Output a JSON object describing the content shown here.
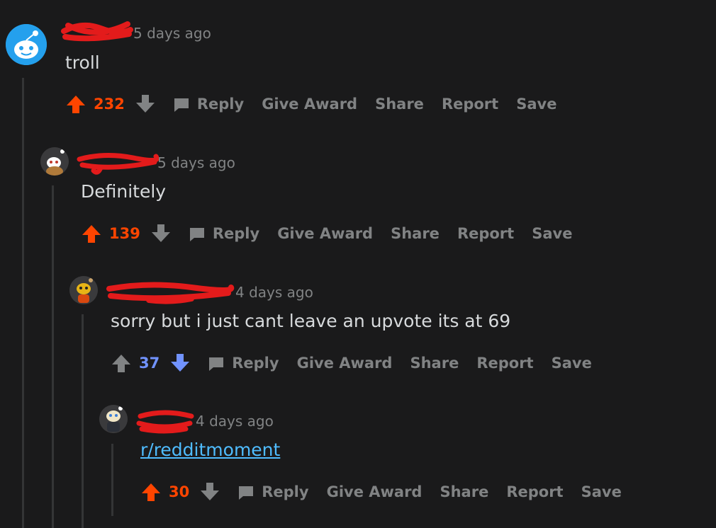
{
  "colors": {
    "upvote": "#ff4500",
    "downvote": "#7193ff",
    "neutral": "#818384",
    "link": "#4fbcff",
    "redact": "#e31b1b"
  },
  "comments": [
    {
      "author": "",
      "time": "5 days ago",
      "body": "troll",
      "score": "232",
      "vote_state": "up",
      "actions": {
        "reply": "Reply",
        "award": "Give Award",
        "share": "Share",
        "report": "Report",
        "save": "Save"
      }
    },
    {
      "author": "",
      "time": "5 days ago",
      "body": "Definitely",
      "score": "139",
      "vote_state": "up",
      "actions": {
        "reply": "Reply",
        "award": "Give Award",
        "share": "Share",
        "report": "Report",
        "save": "Save"
      }
    },
    {
      "author": "",
      "time": "4 days ago",
      "body": "sorry but i just cant leave an upvote its at 69",
      "score": "37",
      "vote_state": "down",
      "actions": {
        "reply": "Reply",
        "award": "Give Award",
        "share": "Share",
        "report": "Report",
        "save": "Save"
      }
    },
    {
      "author": "",
      "time": "4 days ago",
      "body": "r/redditmoment",
      "score": "30",
      "vote_state": "up",
      "actions": {
        "reply": "Reply",
        "award": "Give Award",
        "share": "Share",
        "report": "Report",
        "save": "Save"
      }
    }
  ]
}
